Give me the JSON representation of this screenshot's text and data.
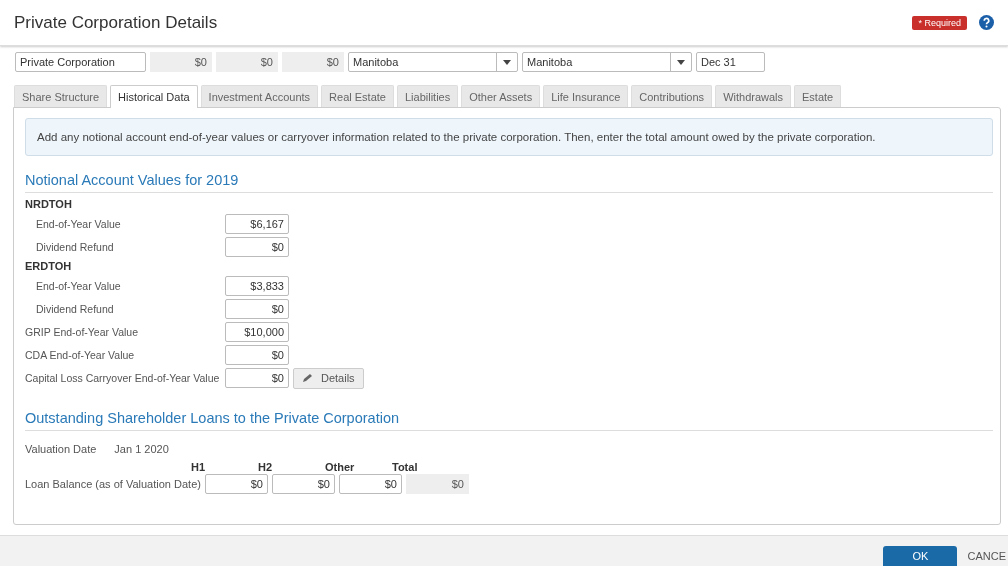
{
  "window": {
    "title": "Private Corporation Details",
    "required_badge": "* Required"
  },
  "top_fields": [
    {
      "kind": "text",
      "value": "Private Corporation"
    },
    {
      "kind": "amount",
      "value": "$0"
    },
    {
      "kind": "amount",
      "value": "$0"
    },
    {
      "kind": "amount",
      "value": "$0"
    },
    {
      "kind": "select",
      "value": "Manitoba"
    },
    {
      "kind": "select",
      "value": "Manitoba"
    },
    {
      "kind": "text",
      "value": "Dec 31"
    }
  ],
  "tabs": [
    {
      "label": "Share Structure",
      "selected": false
    },
    {
      "label": "Historical Data",
      "selected": true
    },
    {
      "label": "Investment Accounts",
      "selected": false
    },
    {
      "label": "Real Estate",
      "selected": false
    },
    {
      "label": "Liabilities",
      "selected": false
    },
    {
      "label": "Other Assets",
      "selected": false
    },
    {
      "label": "Life Insurance",
      "selected": false
    },
    {
      "label": "Contributions",
      "selected": false
    },
    {
      "label": "Withdrawals",
      "selected": false
    },
    {
      "label": "Estate",
      "selected": false
    }
  ],
  "info": "Add any notional account end-of-year values or carryover information related to the private corporation. Then, enter the total amount owed by the private corporation.",
  "notional": {
    "title": "Notional Account Values for 2019",
    "rows": [
      {
        "kind": "heading",
        "label": "NRDTOH"
      },
      {
        "kind": "field",
        "label": "End-of-Year Value",
        "value": "$6,167",
        "indented": true
      },
      {
        "kind": "field",
        "label": "Dividend Refund",
        "value": "$0",
        "indented": true
      },
      {
        "kind": "heading",
        "label": "ERDTOH"
      },
      {
        "kind": "field",
        "label": "End-of-Year Value",
        "value": "$3,833",
        "indented": true
      },
      {
        "kind": "field",
        "label": "Dividend Refund",
        "value": "$0",
        "indented": true
      },
      {
        "kind": "field",
        "label": "GRIP End-of-Year Value",
        "value": "$10,000",
        "indented": false
      },
      {
        "kind": "field",
        "label": "CDA End-of-Year Value",
        "value": "$0",
        "indented": false
      },
      {
        "kind": "field",
        "label": "Capital Loss Carryover End-of-Year Value",
        "value": "$0",
        "indented": false,
        "button": "Details"
      }
    ]
  },
  "loans": {
    "title": "Outstanding Shareholder Loans to the Private Corporation",
    "valuation_label": "Valuation Date",
    "valuation_date": "Jan 1 2020",
    "columns": [
      "H1",
      "H2",
      "Other",
      "Total"
    ],
    "row_label": "Loan Balance (as of Valuation Date)",
    "values": [
      "$0",
      "$0",
      "$0"
    ],
    "total": "$0"
  },
  "footer": {
    "ok": "OK",
    "cancel": "CANCE"
  }
}
